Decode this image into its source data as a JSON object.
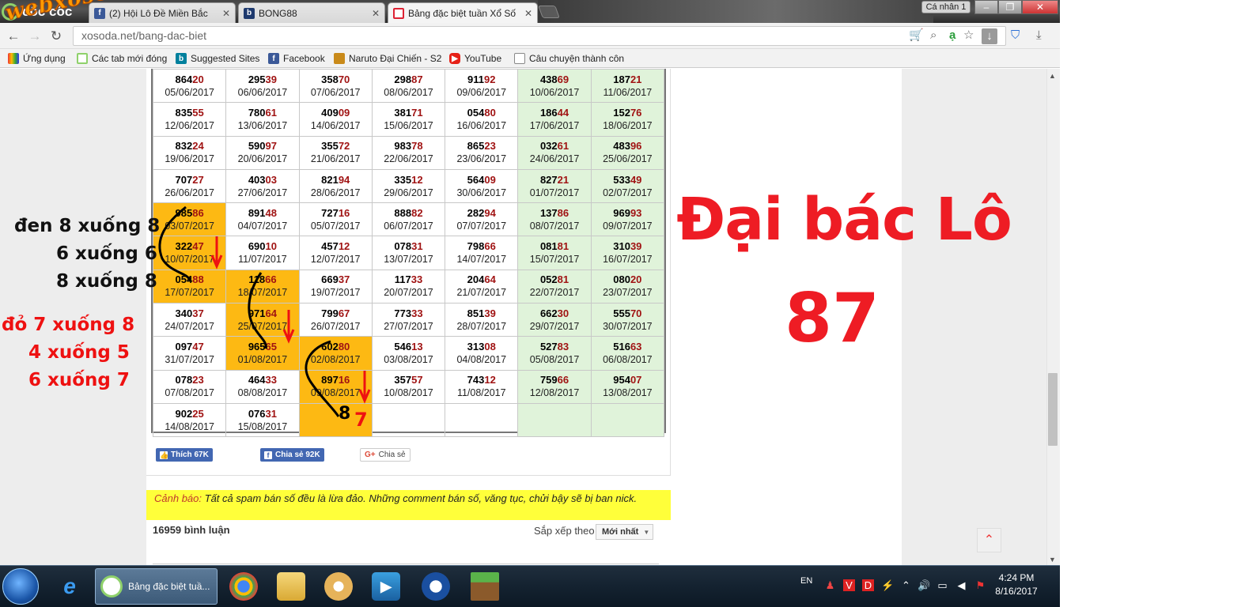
{
  "browser": {
    "brand": "cốc cốc",
    "tabs": [
      {
        "label": "(2) Hội Lô Đề Miền Bắc",
        "favicon": "facebook-icon",
        "color": "#3b5998"
      },
      {
        "label": "BONG88",
        "favicon": "b-letter-icon",
        "color": "#1e3a6e"
      },
      {
        "label": "Bảng đặc biệt tuần Xổ Số",
        "favicon": "xoso-icon",
        "color": "#d23",
        "active": true
      }
    ],
    "profile_label": "Cá nhân 1",
    "url": "xosoda.net/bang-dac-biet",
    "bookmarks": [
      {
        "label": "Ứng dụng",
        "icon": "apps-grid-icon"
      },
      {
        "label": "Các tab mới đóng",
        "icon": "recent-tabs-icon"
      },
      {
        "label": "Suggested Sites",
        "icon": "bing-icon"
      },
      {
        "label": "Facebook",
        "icon": "facebook-icon"
      },
      {
        "label": "Naruto Đại Chiến - S2",
        "icon": "naruto-icon"
      },
      {
        "label": "YouTube",
        "icon": "youtube-icon"
      },
      {
        "label": "Câu chuyện thành côn",
        "icon": "page-icon"
      }
    ],
    "watermark": "webxoso.net"
  },
  "table": {
    "rows": [
      [
        {
          "pre": "864",
          "tail": "20",
          "date": "05/06/2017"
        },
        {
          "pre": "295",
          "tail": "39",
          "date": "06/06/2017"
        },
        {
          "pre": "358",
          "tail": "70",
          "date": "07/06/2017"
        },
        {
          "pre": "298",
          "tail": "87",
          "date": "08/06/2017"
        },
        {
          "pre": "911",
          "tail": "92",
          "date": "09/06/2017"
        },
        {
          "pre": "438",
          "tail": "69",
          "date": "10/06/2017"
        },
        {
          "pre": "187",
          "tail": "21",
          "date": "11/06/2017"
        }
      ],
      [
        {
          "pre": "835",
          "tail": "55",
          "date": "12/06/2017"
        },
        {
          "pre": "780",
          "tail": "61",
          "date": "13/06/2017"
        },
        {
          "pre": "409",
          "tail": "09",
          "date": "14/06/2017"
        },
        {
          "pre": "381",
          "tail": "71",
          "date": "15/06/2017"
        },
        {
          "pre": "054",
          "tail": "80",
          "date": "16/06/2017"
        },
        {
          "pre": "186",
          "tail": "44",
          "date": "17/06/2017"
        },
        {
          "pre": "152",
          "tail": "76",
          "date": "18/06/2017"
        }
      ],
      [
        {
          "pre": "832",
          "tail": "24",
          "date": "19/06/2017"
        },
        {
          "pre": "590",
          "tail": "97",
          "date": "20/06/2017"
        },
        {
          "pre": "355",
          "tail": "72",
          "date": "21/06/2017"
        },
        {
          "pre": "983",
          "tail": "78",
          "date": "22/06/2017"
        },
        {
          "pre": "865",
          "tail": "23",
          "date": "23/06/2017"
        },
        {
          "pre": "032",
          "tail": "61",
          "date": "24/06/2017"
        },
        {
          "pre": "483",
          "tail": "96",
          "date": "25/06/2017"
        }
      ],
      [
        {
          "pre": "707",
          "tail": "27",
          "date": "26/06/2017"
        },
        {
          "pre": "403",
          "tail": "03",
          "date": "27/06/2017"
        },
        {
          "pre": "821",
          "tail": "94",
          "date": "28/06/2017"
        },
        {
          "pre": "335",
          "tail": "12",
          "date": "29/06/2017"
        },
        {
          "pre": "564",
          "tail": "09",
          "date": "30/06/2017"
        },
        {
          "pre": "827",
          "tail": "21",
          "date": "01/07/2017"
        },
        {
          "pre": "533",
          "tail": "49",
          "date": "02/07/2017"
        }
      ],
      [
        {
          "pre": "985",
          "tail": "86",
          "date": "03/07/2017",
          "hl": true
        },
        {
          "pre": "891",
          "tail": "48",
          "date": "04/07/2017"
        },
        {
          "pre": "727",
          "tail": "16",
          "date": "05/07/2017"
        },
        {
          "pre": "888",
          "tail": "82",
          "date": "06/07/2017"
        },
        {
          "pre": "282",
          "tail": "94",
          "date": "07/07/2017"
        },
        {
          "pre": "137",
          "tail": "86",
          "date": "08/07/2017"
        },
        {
          "pre": "969",
          "tail": "93",
          "date": "09/07/2017"
        }
      ],
      [
        {
          "pre": "322",
          "tail": "47",
          "date": "10/07/2017",
          "hl": true
        },
        {
          "pre": "690",
          "tail": "10",
          "date": "11/07/2017"
        },
        {
          "pre": "457",
          "tail": "12",
          "date": "12/07/2017"
        },
        {
          "pre": "078",
          "tail": "31",
          "date": "13/07/2017"
        },
        {
          "pre": "798",
          "tail": "66",
          "date": "14/07/2017"
        },
        {
          "pre": "081",
          "tail": "81",
          "date": "15/07/2017"
        },
        {
          "pre": "310",
          "tail": "39",
          "date": "16/07/2017"
        }
      ],
      [
        {
          "pre": "054",
          "tail": "88",
          "date": "17/07/2017",
          "hl": true
        },
        {
          "pre": "118",
          "tail": "66",
          "date": "18/07/2017",
          "hl": true
        },
        {
          "pre": "669",
          "tail": "37",
          "date": "19/07/2017"
        },
        {
          "pre": "117",
          "tail": "33",
          "date": "20/07/2017"
        },
        {
          "pre": "204",
          "tail": "64",
          "date": "21/07/2017"
        },
        {
          "pre": "052",
          "tail": "81",
          "date": "22/07/2017"
        },
        {
          "pre": "080",
          "tail": "20",
          "date": "23/07/2017"
        }
      ],
      [
        {
          "pre": "340",
          "tail": "37",
          "date": "24/07/2017"
        },
        {
          "pre": "971",
          "tail": "64",
          "date": "25/07/2017",
          "hl": true
        },
        {
          "pre": "799",
          "tail": "67",
          "date": "26/07/2017"
        },
        {
          "pre": "773",
          "tail": "33",
          "date": "27/07/2017"
        },
        {
          "pre": "851",
          "tail": "39",
          "date": "28/07/2017"
        },
        {
          "pre": "662",
          "tail": "30",
          "date": "29/07/2017"
        },
        {
          "pre": "555",
          "tail": "70",
          "date": "30/07/2017"
        }
      ],
      [
        {
          "pre": "097",
          "tail": "47",
          "date": "31/07/2017"
        },
        {
          "pre": "965",
          "tail": "65",
          "date": "01/08/2017",
          "hl": true
        },
        {
          "pre": "602",
          "tail": "80",
          "date": "02/08/2017",
          "hl": true
        },
        {
          "pre": "546",
          "tail": "13",
          "date": "03/08/2017"
        },
        {
          "pre": "313",
          "tail": "08",
          "date": "04/08/2017"
        },
        {
          "pre": "527",
          "tail": "83",
          "date": "05/08/2017"
        },
        {
          "pre": "516",
          "tail": "63",
          "date": "06/08/2017"
        }
      ],
      [
        {
          "pre": "078",
          "tail": "23",
          "date": "07/08/2017"
        },
        {
          "pre": "464",
          "tail": "33",
          "date": "08/08/2017"
        },
        {
          "pre": "897",
          "tail": "16",
          "date": "09/08/2017",
          "hl": true
        },
        {
          "pre": "357",
          "tail": "57",
          "date": "10/08/2017"
        },
        {
          "pre": "743",
          "tail": "12",
          "date": "11/08/2017"
        },
        {
          "pre": "759",
          "tail": "66",
          "date": "12/08/2017"
        },
        {
          "pre": "954",
          "tail": "07",
          "date": "13/08/2017"
        }
      ],
      [
        {
          "pre": "902",
          "tail": "25",
          "date": "14/08/2017"
        },
        {
          "pre": "076",
          "tail": "31",
          "date": "15/08/2017"
        },
        {
          "pre": "",
          "tail": "",
          "date": "",
          "hl": true
        },
        {
          "pre": "",
          "tail": "",
          "date": ""
        },
        {
          "pre": "",
          "tail": "",
          "date": ""
        },
        {
          "pre": "",
          "tail": "",
          "date": ""
        },
        {
          "pre": "",
          "tail": "",
          "date": ""
        }
      ]
    ]
  },
  "share": {
    "like": "Thích 67K",
    "share": "Chia sẻ 92K",
    "gplus": "Chia sẻ"
  },
  "warning": {
    "label": "Cảnh báo:",
    "text": "Tất cả spam bán số đều là lừa đảo. Những comment bán số, văng tục, chửi bậy sẽ bị ban nick."
  },
  "comments": {
    "count": "16959 bình luận",
    "sort_label": "Sắp xếp theo",
    "sort_value": "Mới nhất"
  },
  "annotations": {
    "black": [
      "đen 8 xuống 8",
      "6 xuống 6",
      "8 xuống 8"
    ],
    "red": [
      "đỏ 7 xuống 8",
      "4 xuống 5",
      "6 xuống 7"
    ],
    "cell_digit_black": "8",
    "cell_digit_red": "7",
    "title": "Đại bác Lô",
    "number": "87"
  },
  "taskbar": {
    "active_task": "Bảng đặc biệt tuầ...",
    "lang": "EN",
    "time": "4:24 PM",
    "date": "8/16/2017"
  }
}
